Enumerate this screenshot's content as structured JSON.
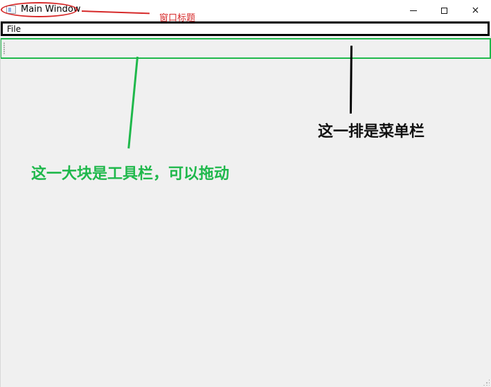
{
  "window": {
    "title": "Main Window",
    "controls": {
      "minimize_icon": "minimize-icon",
      "maximize_icon": "maximize-icon",
      "close_icon": "close-icon",
      "close_symbol": "×"
    }
  },
  "menu_bar": {
    "items": [
      {
        "label": "File"
      }
    ]
  },
  "annotations": {
    "window_title": "窗口标题",
    "menu_bar": "这一排是菜单栏",
    "toolbar": "这一大块是工具栏，可以拖动"
  },
  "colors": {
    "window_background": "#f0f0f0",
    "title_annotation": "#d62828",
    "menu_annotation": "#111111",
    "toolbar_annotation": "#1fb84b"
  }
}
